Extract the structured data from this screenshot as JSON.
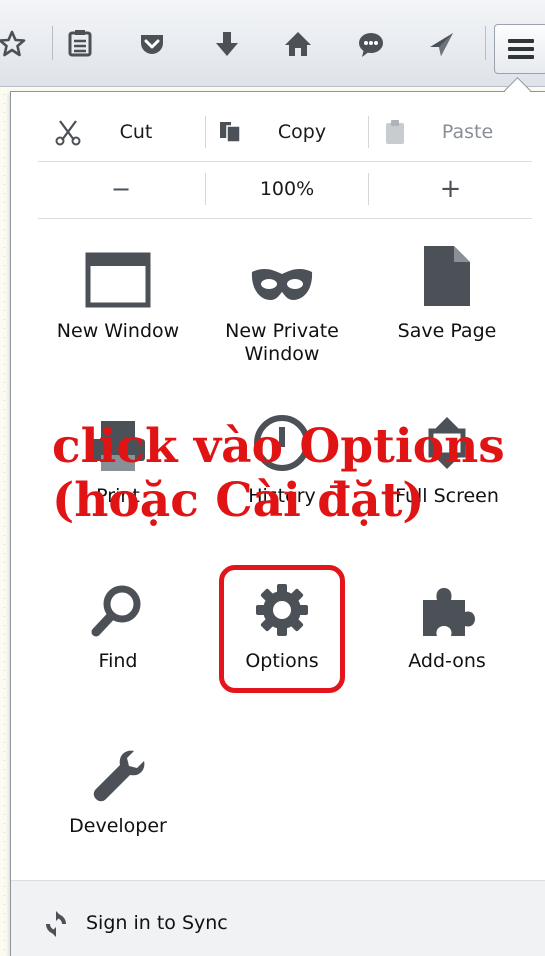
{
  "toolbar": {
    "icons": [
      "bookmark-star-icon",
      "bookmarks-list-icon",
      "pocket-icon",
      "download-icon",
      "home-icon",
      "chat-icon",
      "send-icon"
    ],
    "menu_button": "hamburger-menu-icon"
  },
  "edit": {
    "cut": "Cut",
    "copy": "Copy",
    "paste": "Paste",
    "zoom_out": "−",
    "zoom": "100%",
    "zoom_in": "+"
  },
  "items": {
    "new_window": "New Window",
    "new_private_window": "New Private Window",
    "save_page": "Save Page",
    "print": "Print",
    "history": "History",
    "full_screen": "Full Screen",
    "find": "Find",
    "options": "Options",
    "addons": "Add-ons",
    "developer": "Developer"
  },
  "footer": {
    "sync": "Sign in to Sync"
  },
  "annotation": {
    "line1": "click vào Options",
    "line2": "(hoặc Cài đặt)",
    "color": "#e01414"
  }
}
